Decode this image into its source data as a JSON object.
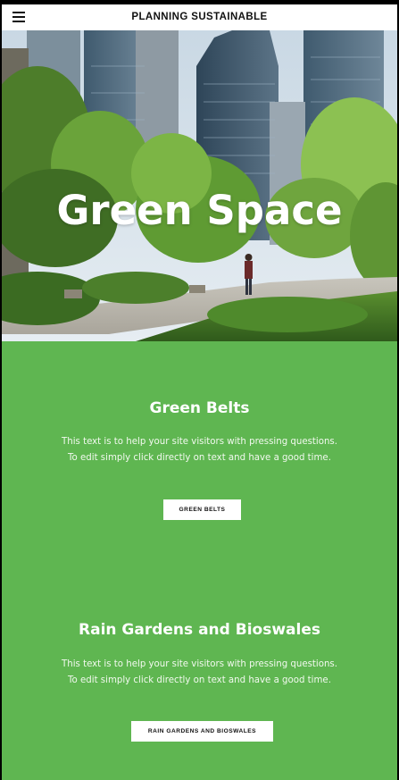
{
  "header": {
    "site_title": "PLANNING SUSTAINABLE",
    "menu_icon": "hamburger-menu-icon"
  },
  "hero": {
    "title": "Green Space",
    "image": "city-park-with-trees-and-skyscrapers"
  },
  "sections": [
    {
      "title": "Green Belts",
      "text_line1": "This text is to help your site visitors with pressing questions.",
      "text_line2": "To edit simply click directly on text and have a good time.",
      "button_label": "GREEN BELTS"
    },
    {
      "title": "Rain Gardens and Bioswales",
      "text_line1": "This text is to help your site visitors with pressing questions.",
      "text_line2": "To edit simply click directly on text and have a good time.",
      "button_label": "RAIN GARDENS AND BIOSWALES"
    }
  ],
  "colors": {
    "section_background": "#5fb651",
    "header_background": "#ffffff",
    "button_background": "#ffffff"
  }
}
